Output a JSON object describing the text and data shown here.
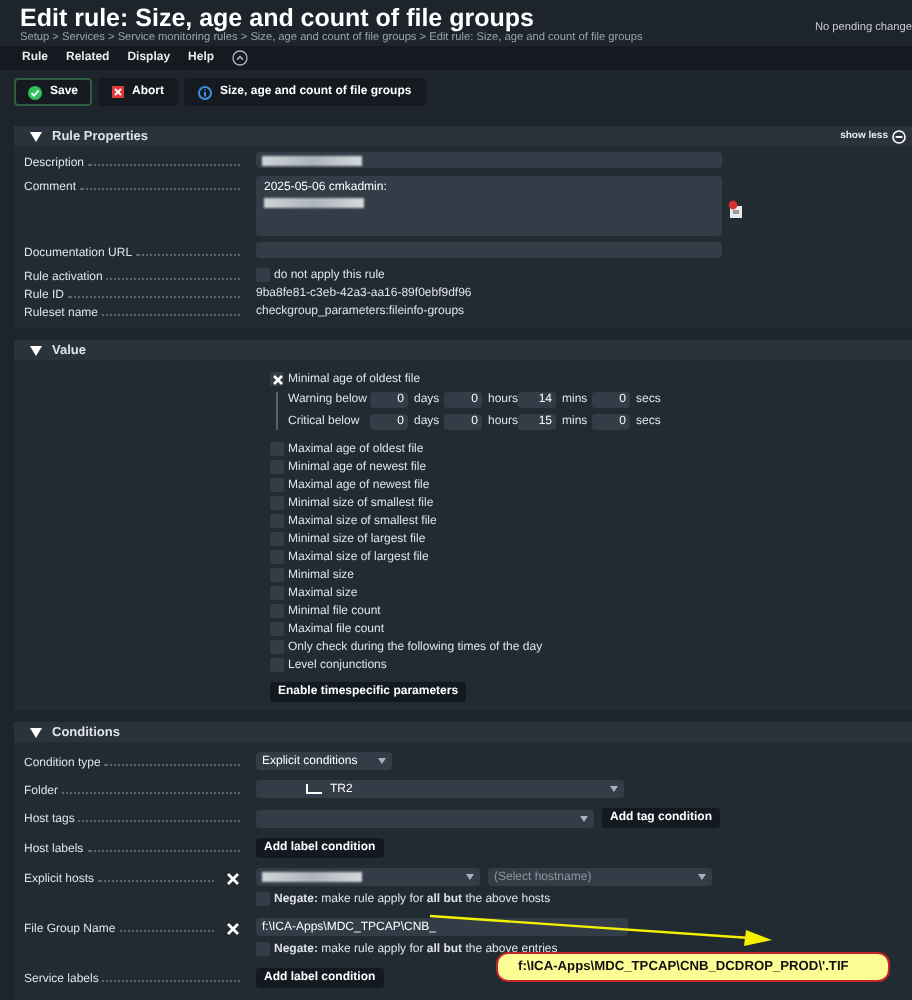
{
  "page": {
    "title": "Edit rule: Size, age and count of file groups",
    "breadcrumb": "Setup > Services > Service monitoring rules > Size, age and count of file groups > Edit rule: Size, age and count of file groups",
    "pending": "No pending change"
  },
  "menu": [
    {
      "label": "Rule"
    },
    {
      "label": "Related"
    },
    {
      "label": "Display"
    },
    {
      "label": "Help"
    }
  ],
  "toolbar": [
    {
      "kind": "save",
      "label": "Save"
    },
    {
      "kind": "abort",
      "label": "Abort"
    },
    {
      "kind": "info",
      "label": "Size, age and count of file groups"
    }
  ],
  "rule_properties": {
    "title": "Rule Properties",
    "expanded": true,
    "show_less": "show less",
    "rows": [
      {
        "kind": "input",
        "label": "Description",
        "redacted": true
      },
      {
        "kind": "textarea",
        "label": "Comment",
        "value": "2025-05-06 cmkadmin:",
        "redacted": true
      },
      {
        "kind": "input",
        "label": "Documentation URL",
        "redacted": false
      },
      {
        "kind": "checkbox",
        "label": "Rule activation",
        "text": "do not apply this rule",
        "checked": false
      },
      {
        "kind": "text",
        "label": "Rule ID",
        "value": "9ba8fe81-c3eb-42a3-aa16-89f0ebf9df96"
      },
      {
        "kind": "text",
        "label": "Ruleset name",
        "value": "checkgroup_parameters:fileinfo-groups"
      }
    ]
  },
  "value": {
    "title": "Value",
    "expanded": true,
    "options": [
      {
        "label": "Minimal age of oldest file",
        "checked": true,
        "thresholds": [
          {
            "label": "Warning below",
            "fields": [
              {
                "value": "0",
                "unit": "days"
              },
              {
                "value": "0",
                "unit": "hours"
              },
              {
                "value": "14",
                "unit": "mins"
              },
              {
                "value": "0",
                "unit": "secs"
              }
            ]
          },
          {
            "label": "Critical below",
            "fields": [
              {
                "value": "0",
                "unit": "days"
              },
              {
                "value": "0",
                "unit": "hours"
              },
              {
                "value": "15",
                "unit": "mins"
              },
              {
                "value": "0",
                "unit": "secs"
              }
            ]
          }
        ]
      },
      {
        "label": "Maximal age of oldest file",
        "checked": false
      },
      {
        "label": "Minimal age of newest file",
        "checked": false
      },
      {
        "label": "Maximal age of newest file",
        "checked": false
      },
      {
        "label": "Minimal size of smallest file",
        "checked": false
      },
      {
        "label": "Maximal size of smallest file",
        "checked": false
      },
      {
        "label": "Minimal size of largest file",
        "checked": false
      },
      {
        "label": "Maximal size of largest file",
        "checked": false
      },
      {
        "label": "Minimal size",
        "checked": false
      },
      {
        "label": "Maximal size",
        "checked": false
      },
      {
        "label": "Minimal file count",
        "checked": false
      },
      {
        "label": "Maximal file count",
        "checked": false
      },
      {
        "label": "Only check during the following times of the day",
        "checked": false
      },
      {
        "label": "Level conjunctions",
        "checked": false
      }
    ],
    "button": "Enable timespecific parameters"
  },
  "conditions": {
    "title": "Conditions",
    "expanded": true,
    "rows": [
      {
        "kind": "select",
        "label": "Condition type",
        "value": "Explicit conditions"
      },
      {
        "kind": "folder",
        "label": "Folder",
        "value": "TR2"
      },
      {
        "kind": "tags",
        "label": "Host tags",
        "button": "Add tag condition"
      },
      {
        "kind": "button",
        "label": "Host labels",
        "button": "Add label condition"
      },
      {
        "kind": "hosts",
        "label": "Explicit hosts",
        "placeholder": "(Select hostname)",
        "negate": "**Negate:** make rule apply for **all but** the above hosts",
        "negated": false
      },
      {
        "kind": "entries",
        "label": "File Group Name",
        "value": "f:\\ICA-Apps\\MDC_TPCAP\\CNB_",
        "negate": "**Negate:** make rule apply for **all but** the above entries",
        "negated": false
      },
      {
        "kind": "button",
        "label": "Service labels",
        "button": "Add label condition"
      }
    ]
  },
  "annotation": {
    "text": "f:\\ICA-Apps\\MDC_TPCAP\\CNB_DCDROP_PROD\\'.TIF"
  }
}
